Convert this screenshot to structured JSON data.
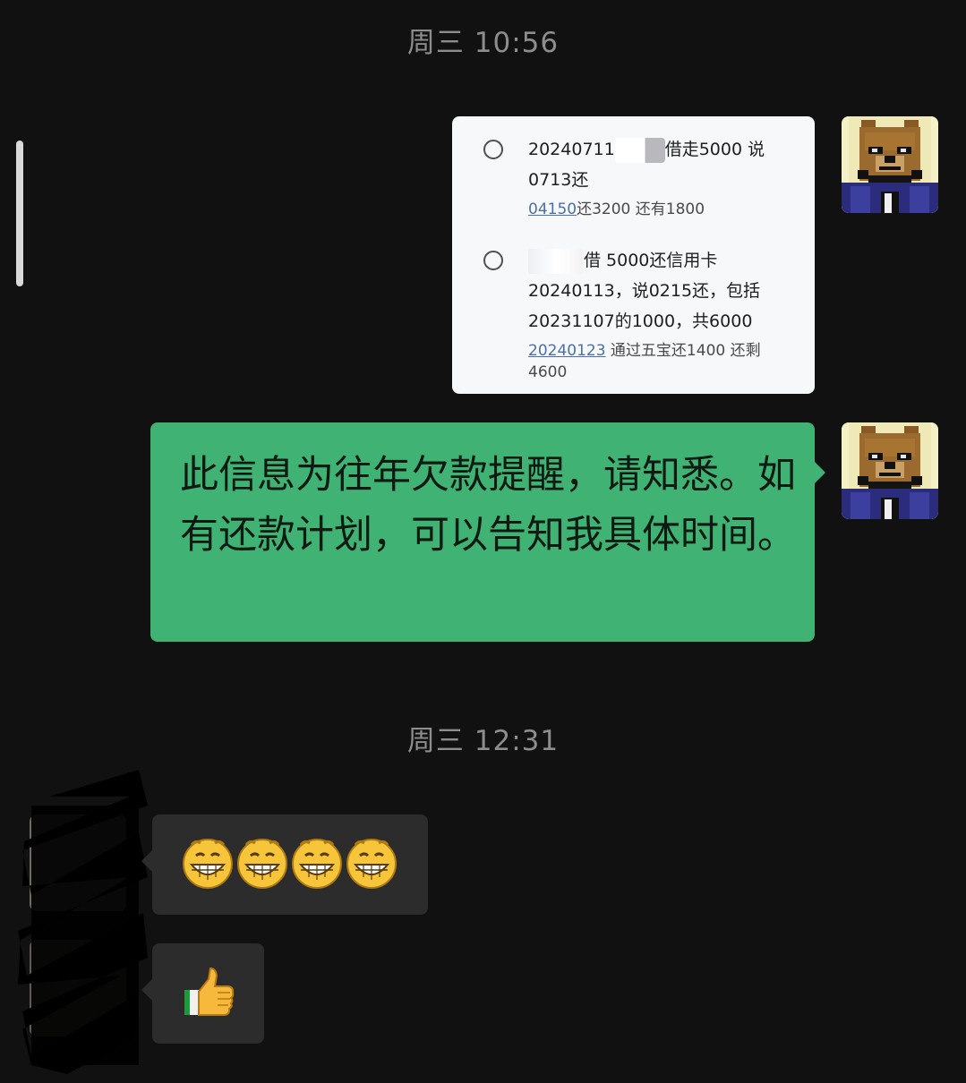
{
  "chat": {
    "timestamps": [
      "周三 10:56",
      "周三 12:31"
    ],
    "screenshot_card": {
      "items": [
        {
          "line1_prefix": "20240711",
          "line1_suffix": "借走5000 说",
          "line2": "0713还",
          "sub_link": "04150",
          "sub_text": "还3200 还有1800"
        },
        {
          "line1_suffix": "借 5000还信用卡",
          "line2": "20240113，说0215还，包括",
          "line3": "20231107的1000，共6000",
          "sub_link": "20240123",
          "sub_text": " 通过五宝还1400 还剩",
          "sub_line2": "4600"
        }
      ]
    },
    "outgoing_message": {
      "text": "此信息为往年欠款提醒，请知悉。如有还款计划，可以告知我具体时间。"
    },
    "incoming_messages": [
      {
        "type": "emoji",
        "emojis": [
          "grin-emoji",
          "grin-emoji",
          "grin-emoji",
          "grin-emoji"
        ]
      },
      {
        "type": "emoji",
        "emojis": [
          "thumbs-up-emoji"
        ]
      }
    ]
  },
  "colors": {
    "background": "#111111",
    "outgoing_bubble": "#3fb274",
    "incoming_bubble": "#2c2c2c",
    "timestamp_text": "#8d8d8d",
    "link": "#4b6fa8"
  }
}
